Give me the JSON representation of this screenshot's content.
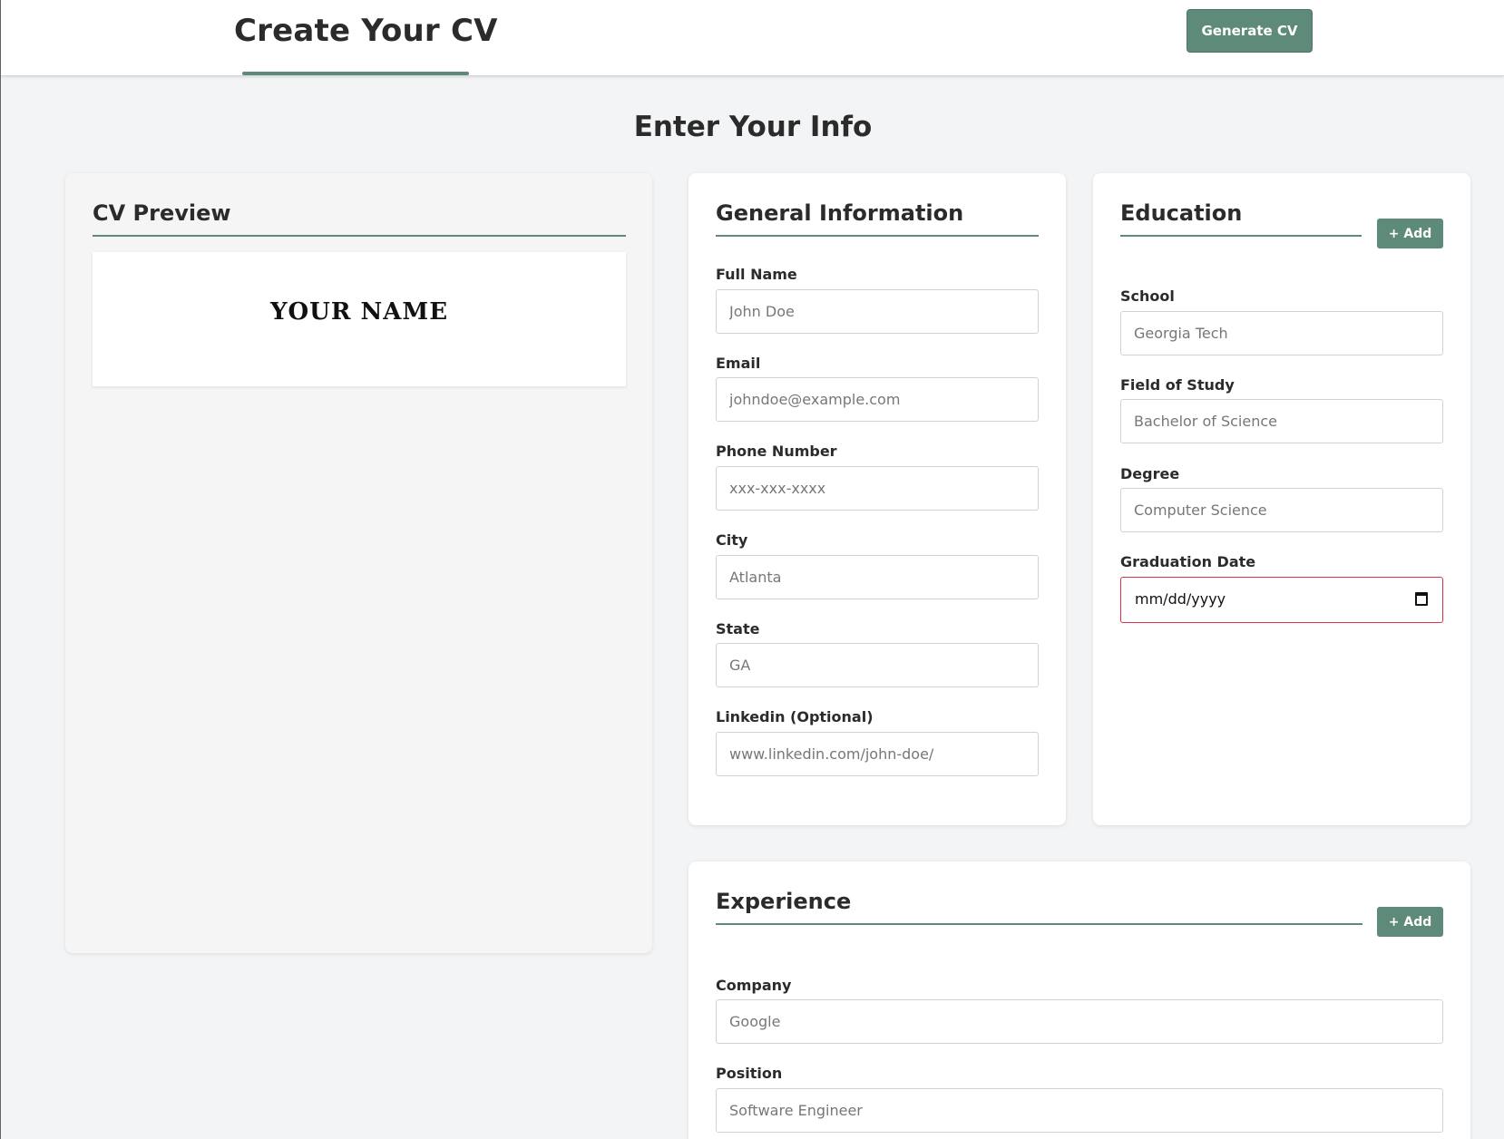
{
  "header": {
    "title": "Create Your CV",
    "generate_label": "Generate CV"
  },
  "page": {
    "heading": "Enter Your Info"
  },
  "preview": {
    "title": "CV Preview",
    "name": "YOUR NAME"
  },
  "general": {
    "title": "General Information",
    "fields": [
      {
        "label": "Full Name",
        "placeholder": "John Doe"
      },
      {
        "label": "Email",
        "placeholder": "johndoe@example.com"
      },
      {
        "label": "Phone Number",
        "placeholder": "xxx-xxx-xxxx"
      },
      {
        "label": "City",
        "placeholder": "Atlanta"
      },
      {
        "label": "State",
        "placeholder": "GA"
      },
      {
        "label": "Linkedin (Optional)",
        "placeholder": "www.linkedin.com/john-doe/"
      }
    ]
  },
  "education": {
    "title": "Education",
    "add_label": "+ Add",
    "fields": [
      {
        "label": "School",
        "placeholder": "Georgia Tech"
      },
      {
        "label": "Field of Study",
        "placeholder": "Bachelor of Science"
      },
      {
        "label": "Degree",
        "placeholder": "Computer Science"
      },
      {
        "label": "Graduation Date",
        "value": "mm/dd/yyyy"
      }
    ]
  },
  "experience": {
    "title": "Experience",
    "add_label": "+ Add",
    "fields": [
      {
        "label": "Company",
        "placeholder": "Google"
      },
      {
        "label": "Position",
        "placeholder": "Software Engineer"
      }
    ]
  },
  "colors": {
    "accent": "#5e8a79",
    "background": "#f3f4f5",
    "invalid_border": "#d9334c"
  }
}
